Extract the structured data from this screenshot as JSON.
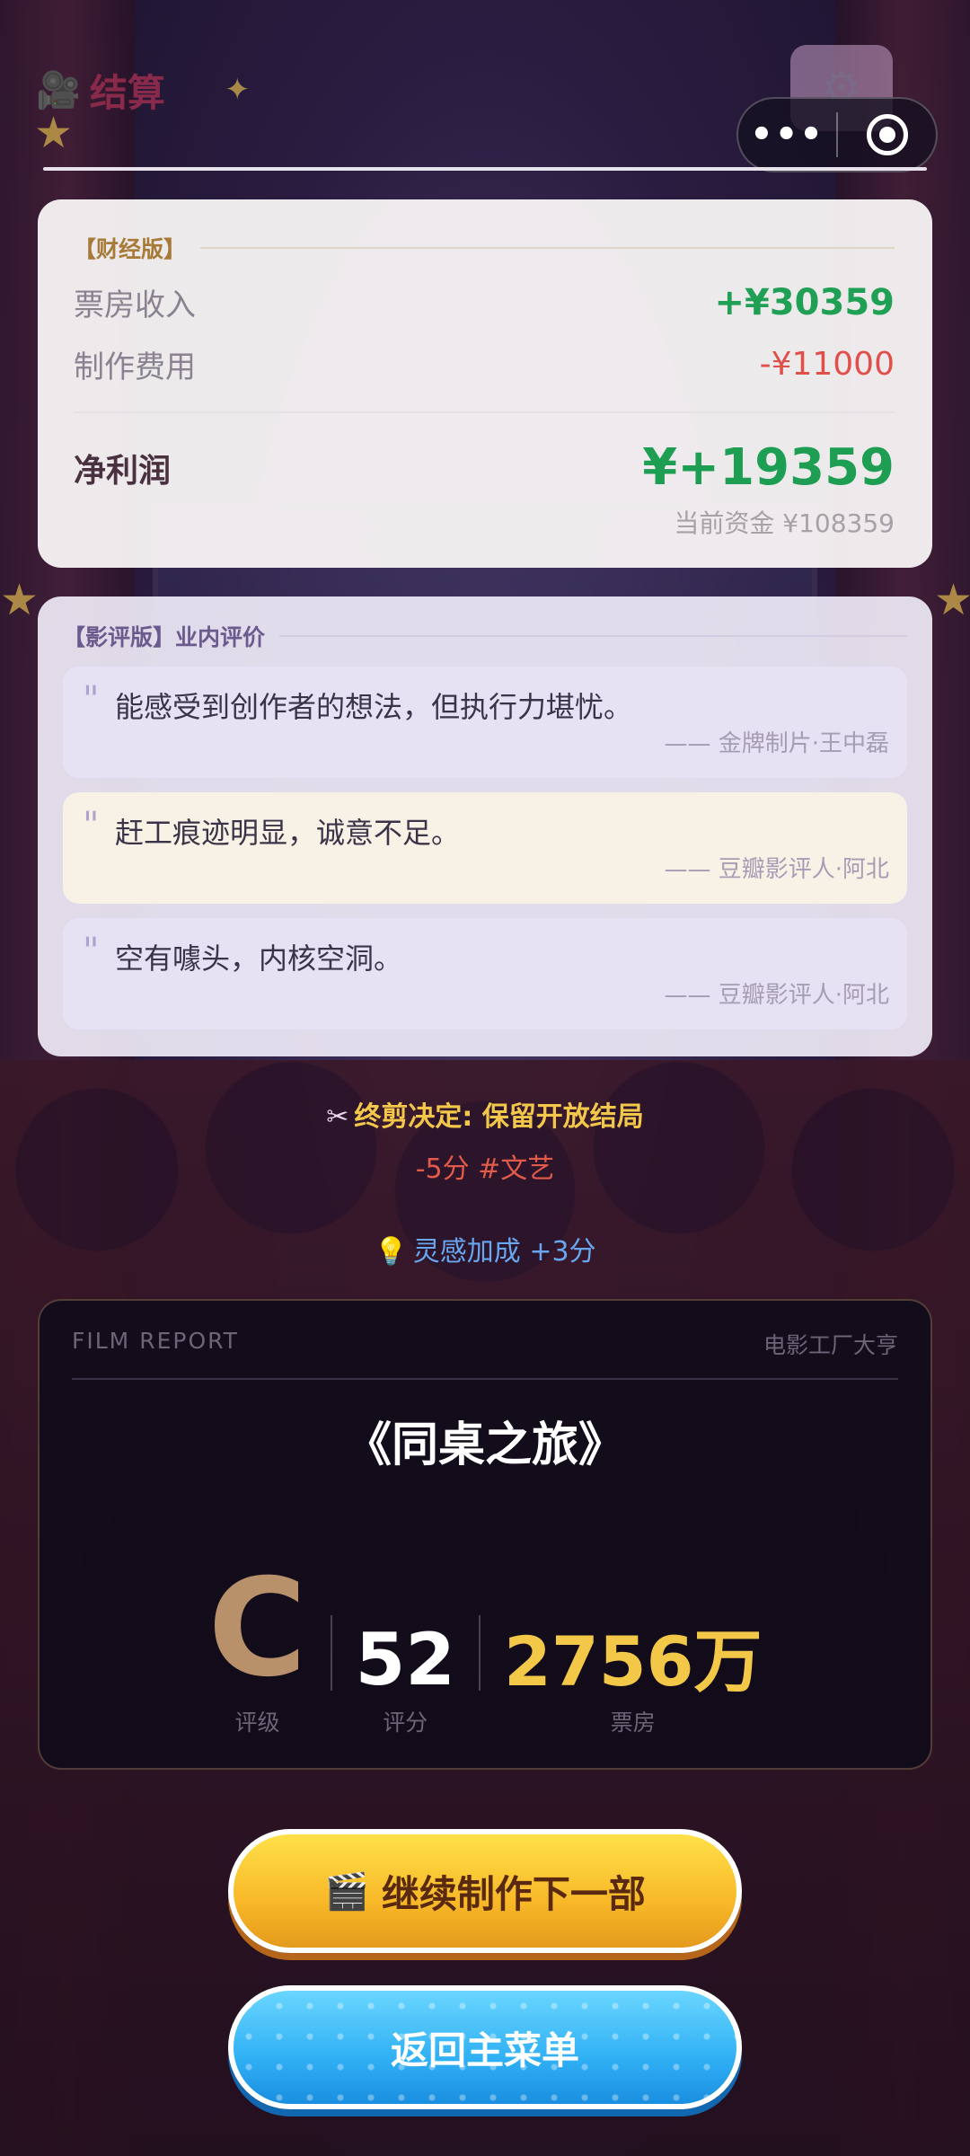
{
  "header": {
    "title": "结算",
    "camera_icon": "movie-camera-icon",
    "settings_icon": "gear-icon"
  },
  "finance": {
    "tag": "【财经版】",
    "income_label": "票房收入",
    "income_value": "+¥30359",
    "cost_label": "制作费用",
    "cost_value": "-¥11000",
    "profit_label": "净利润",
    "profit_value": "¥+19359",
    "current_fund": "当前资金 ¥108359"
  },
  "reviews": {
    "tag": "【影评版】业内评价",
    "items": [
      {
        "text": "能感受到创作者的想法，但执行力堪忧。",
        "source": "—— 金牌制片·王中磊"
      },
      {
        "text": "赶工痕迹明显，诚意不足。",
        "source": "—— 豆瓣影评人·阿北"
      },
      {
        "text": "空有噱头，内核空洞。",
        "source": "—— 豆瓣影评人·阿北"
      }
    ]
  },
  "decision": {
    "final_cut": "终剪决定: 保留开放结局",
    "effect": "-5分 #文艺",
    "inspiration": "灵感加成 +3分"
  },
  "report": {
    "label": "FILM REPORT",
    "studio": "电影工厂大亨",
    "film_title": "《同桌之旅》",
    "grade": "C",
    "grade_label": "评级",
    "score": "52",
    "score_label": "评分",
    "box_office": "2756万",
    "box_office_label": "票房"
  },
  "buttons": {
    "next": "继续制作下一部",
    "menu": "返回主菜单"
  },
  "colors": {
    "profit_green": "#1d9e52",
    "cost_red": "#e0504a",
    "gold": "#f3c848",
    "grade_bronze": "#b8916a"
  }
}
